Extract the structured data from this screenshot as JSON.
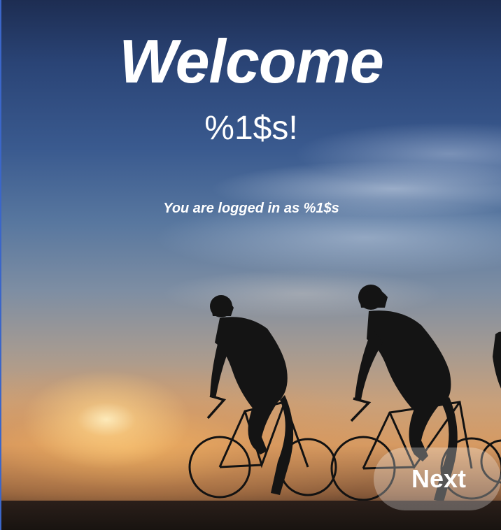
{
  "welcome": {
    "title": "Welcome",
    "username_placeholder": "%1$s!",
    "logged_in_text": "You are logged in as %1$s"
  },
  "actions": {
    "next_label": "Next"
  },
  "colors": {
    "text": "#ffffff",
    "button_bg": "rgba(255,255,255,0.28)",
    "sky_top": "#1d2d52",
    "sunset": "#d69a62"
  },
  "background": {
    "scene_icon": "cyclists-sunset-photo"
  }
}
